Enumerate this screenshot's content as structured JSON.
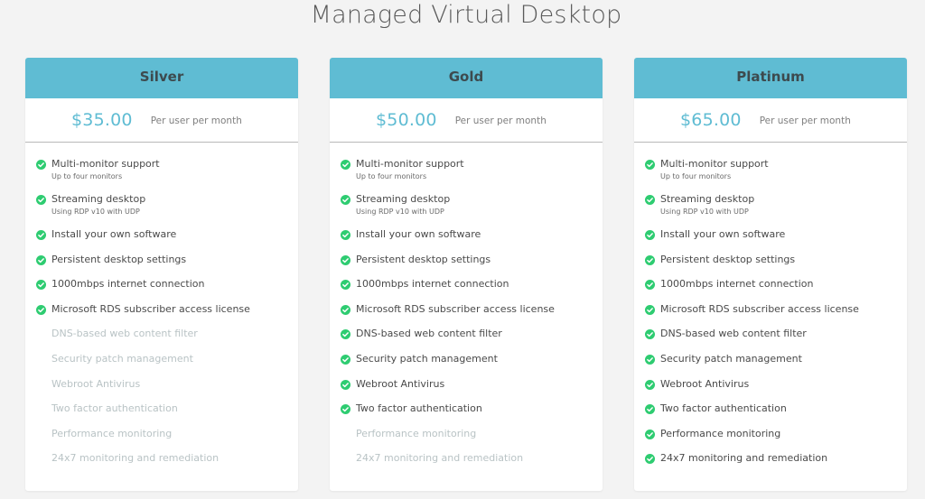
{
  "page": {
    "title": "Managed Virtual Desktop"
  },
  "colors": {
    "accent": "#5fbcd3",
    "check": "#2ecc71",
    "disabled_text": "#b9c3c5"
  },
  "plans": [
    {
      "name": "Silver",
      "price": "$35.00",
      "period": "Per user per month",
      "features": [
        {
          "label": "Multi-monitor support",
          "sub": "Up to four monitors",
          "included": true
        },
        {
          "label": "Streaming desktop",
          "sub": "Using RDP v10 with UDP",
          "included": true
        },
        {
          "label": "Install your own software",
          "sub": "",
          "included": true
        },
        {
          "label": "Persistent desktop settings",
          "sub": "",
          "included": true
        },
        {
          "label": "1000mbps internet connection",
          "sub": "",
          "included": true
        },
        {
          "label": "Microsoft RDS subscriber access license",
          "sub": "",
          "included": true
        },
        {
          "label": "DNS-based web content filter",
          "sub": "",
          "included": false
        },
        {
          "label": "Security patch management",
          "sub": "",
          "included": false
        },
        {
          "label": "Webroot Antivirus",
          "sub": "",
          "included": false
        },
        {
          "label": "Two factor authentication",
          "sub": "",
          "included": false
        },
        {
          "label": "Performance monitoring",
          "sub": "",
          "included": false
        },
        {
          "label": "24x7 monitoring and remediation",
          "sub": "",
          "included": false
        }
      ]
    },
    {
      "name": "Gold",
      "price": "$50.00",
      "period": "Per user per month",
      "features": [
        {
          "label": "Multi-monitor support",
          "sub": "Up to four monitors",
          "included": true
        },
        {
          "label": "Streaming desktop",
          "sub": "Using RDP v10 with UDP",
          "included": true
        },
        {
          "label": "Install your own software",
          "sub": "",
          "included": true
        },
        {
          "label": "Persistent desktop settings",
          "sub": "",
          "included": true
        },
        {
          "label": "1000mbps internet connection",
          "sub": "",
          "included": true
        },
        {
          "label": "Microsoft RDS subscriber access license",
          "sub": "",
          "included": true
        },
        {
          "label": "DNS-based web content filter",
          "sub": "",
          "included": true
        },
        {
          "label": "Security patch management",
          "sub": "",
          "included": true
        },
        {
          "label": "Webroot Antivirus",
          "sub": "",
          "included": true
        },
        {
          "label": "Two factor authentication",
          "sub": "",
          "included": true
        },
        {
          "label": "Performance monitoring",
          "sub": "",
          "included": false
        },
        {
          "label": "24x7 monitoring and remediation",
          "sub": "",
          "included": false
        }
      ]
    },
    {
      "name": "Platinum",
      "price": "$65.00",
      "period": "Per user per month",
      "features": [
        {
          "label": "Multi-monitor support",
          "sub": "Up to four monitors",
          "included": true
        },
        {
          "label": "Streaming desktop",
          "sub": "Using RDP v10 with UDP",
          "included": true
        },
        {
          "label": "Install your own software",
          "sub": "",
          "included": true
        },
        {
          "label": "Persistent desktop settings",
          "sub": "",
          "included": true
        },
        {
          "label": "1000mbps internet connection",
          "sub": "",
          "included": true
        },
        {
          "label": "Microsoft RDS subscriber access license",
          "sub": "",
          "included": true
        },
        {
          "label": "DNS-based web content filter",
          "sub": "",
          "included": true
        },
        {
          "label": "Security patch management",
          "sub": "",
          "included": true
        },
        {
          "label": "Webroot Antivirus",
          "sub": "",
          "included": true
        },
        {
          "label": "Two factor authentication",
          "sub": "",
          "included": true
        },
        {
          "label": "Performance monitoring",
          "sub": "",
          "included": true
        },
        {
          "label": "24x7 monitoring and remediation",
          "sub": "",
          "included": true
        }
      ]
    }
  ]
}
